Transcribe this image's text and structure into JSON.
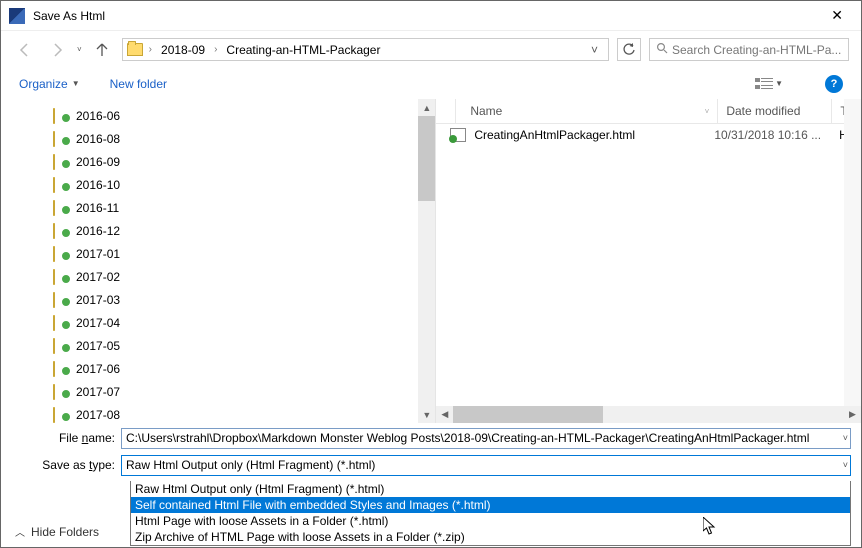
{
  "window": {
    "title": "Save As Html"
  },
  "breadcrumbs": {
    "seg1": "2018-09",
    "seg2": "Creating-an-HTML-Packager"
  },
  "search": {
    "placeholder": "Search Creating-an-HTML-Pa..."
  },
  "toolbar": {
    "organize": "Organize",
    "newfolder": "New folder"
  },
  "tree": {
    "items": [
      "2016-06",
      "2016-08",
      "2016-09",
      "2016-10",
      "2016-11",
      "2016-12",
      "2017-01",
      "2017-02",
      "2017-03",
      "2017-04",
      "2017-05",
      "2017-06",
      "2017-07",
      "2017-08"
    ]
  },
  "columns": {
    "name": "Name",
    "date": "Date modified",
    "type": "Ty"
  },
  "files": [
    {
      "name": "CreatingAnHtmlPackager.html",
      "date": "10/31/2018 10:16 ...",
      "type": "H"
    }
  ],
  "labels": {
    "filename": "File name:",
    "saveastype": "Save as type:",
    "hidefolders": "Hide Folders",
    "filename_key": "n",
    "saveastype_key": "t"
  },
  "fields": {
    "filename": "C:\\Users\\rstrahl\\Dropbox\\Markdown Monster Weblog Posts\\2018-09\\Creating-an-HTML-Packager\\CreatingAnHtmlPackager.html",
    "saveastype": "Raw Html Output only (Html Fragment) (*.html)"
  },
  "dropdown": {
    "options": [
      "Raw Html Output only (Html Fragment) (*.html)",
      "Self contained Html File with embedded Styles and Images (*.html)",
      "Html Page with loose Assets in a Folder (*.html)",
      "Zip Archive of HTML Page  with loose Assets in a Folder (*.zip)"
    ],
    "selected_index": 1
  }
}
